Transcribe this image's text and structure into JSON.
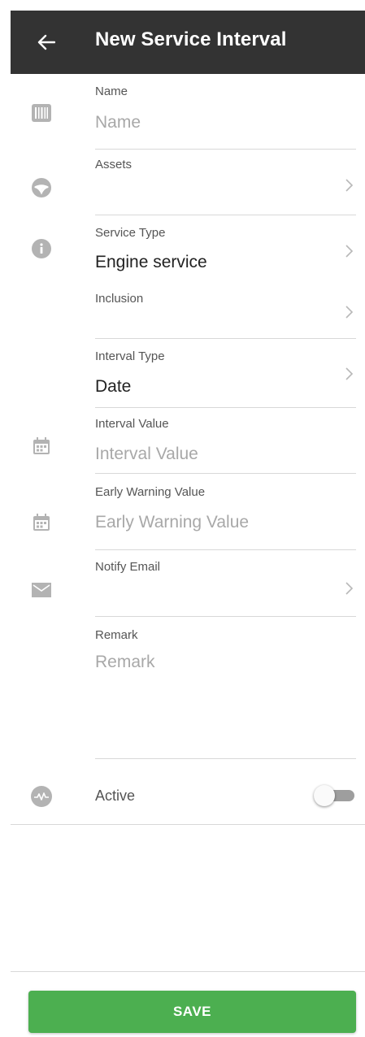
{
  "appbar": {
    "back_icon": "arrow-left-icon",
    "title": "New Service Interval"
  },
  "form": {
    "name": {
      "label": "Name",
      "placeholder": "Name",
      "icon": "barcode-icon"
    },
    "assets": {
      "label": "Assets",
      "icon": "steering-wheel-icon"
    },
    "service_type": {
      "label": "Service Type",
      "value": "Engine service",
      "icon": "info-icon"
    },
    "inclusion": {
      "label": "Inclusion"
    },
    "interval_type": {
      "label": "Interval Type",
      "value": "Date"
    },
    "interval_value": {
      "label": "Interval Value",
      "placeholder": "Interval Value",
      "icon": "calendar-icon"
    },
    "early_warning": {
      "label": "Early Warning Value",
      "placeholder": "Early Warning Value",
      "icon": "calendar-icon"
    },
    "notify_email": {
      "label": "Notify Email",
      "icon": "mail-icon"
    },
    "remark": {
      "label": "Remark",
      "placeholder": "Remark"
    },
    "active": {
      "label": "Active",
      "enabled": false,
      "icon": "pulse-icon"
    }
  },
  "save_button": {
    "label": "SAVE"
  },
  "colors": {
    "appbar_bg": "#333333",
    "icon_gray": "#b3b3b3",
    "save_green": "#4caf50",
    "divider": "#d8d8d8",
    "placeholder": "#a8a8a8"
  }
}
